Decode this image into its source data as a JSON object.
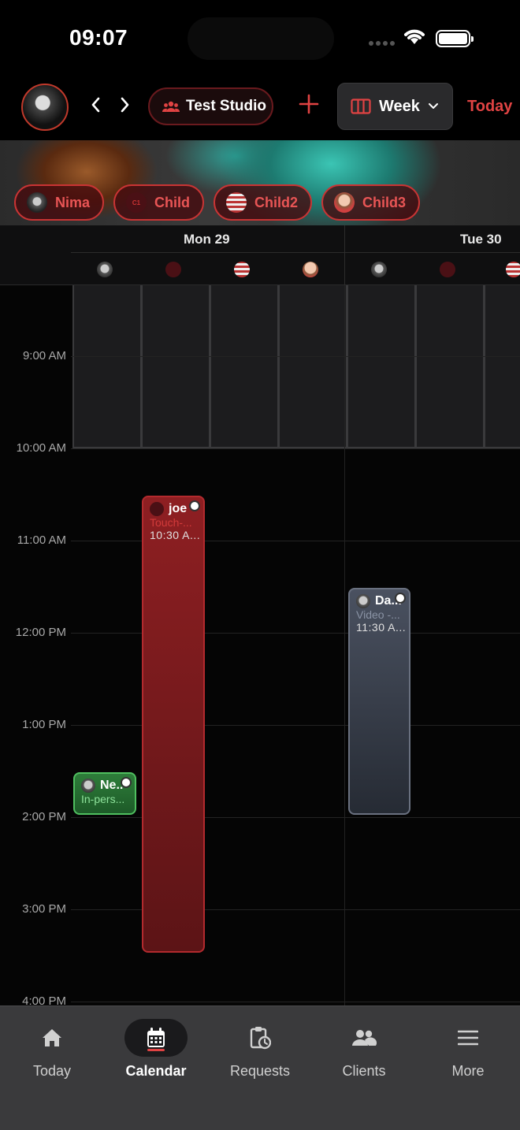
{
  "status_bar": {
    "time": "09:07"
  },
  "header": {
    "studio_label": "Test Studio",
    "view_label": "Week",
    "today_label": "Today"
  },
  "staff_chips": [
    {
      "label": "Nima"
    },
    {
      "label": "Child"
    },
    {
      "label": "Child2"
    },
    {
      "label": "Child3"
    }
  ],
  "days": [
    {
      "label": "Mon 29"
    },
    {
      "label": "Tue 30"
    }
  ],
  "hours": [
    "9:00 AM",
    "10:00 AM",
    "11:00 AM",
    "12:00 PM",
    "1:00 PM",
    "2:00 PM",
    "3:00 PM",
    "4:00 PM"
  ],
  "events": {
    "joe": {
      "title": "joe",
      "subtitle": "Touch-...",
      "time": "10:30 A..."
    },
    "da": {
      "title": "Da...",
      "subtitle": "Video -...",
      "time": "11:30 A..."
    },
    "ne": {
      "title": "Ne..",
      "subtitle": "In-pers..."
    }
  },
  "tabs": [
    {
      "label": "Today",
      "icon": "home-icon"
    },
    {
      "label": "Calendar",
      "icon": "calendar-icon"
    },
    {
      "label": "Requests",
      "icon": "clipboard-clock-icon"
    },
    {
      "label": "Clients",
      "icon": "people-icon"
    },
    {
      "label": "More",
      "icon": "menu-icon"
    }
  ],
  "colors": {
    "accent": "#e04343",
    "event_red": "#8e1f22",
    "event_gray": "#4a5160",
    "event_green": "#2e7d3a"
  }
}
